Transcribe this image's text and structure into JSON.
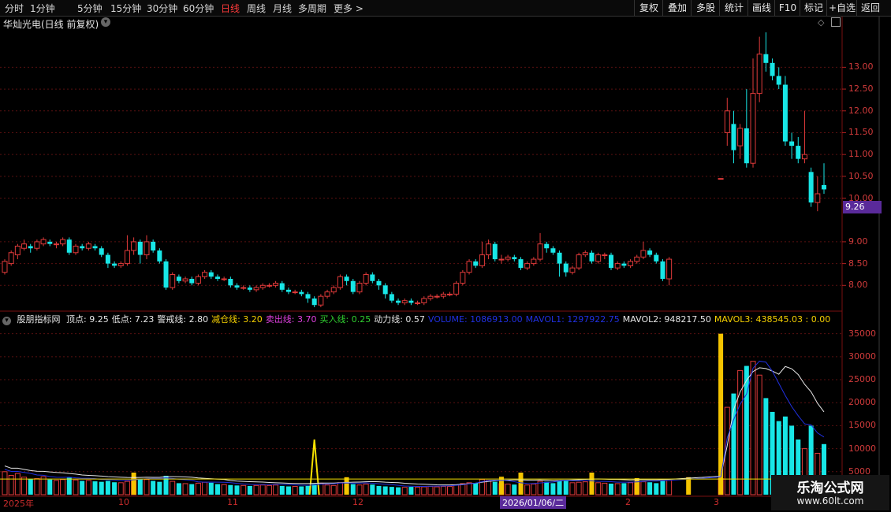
{
  "toolbar": {
    "periods": [
      "分时",
      "1分钟",
      "5分钟",
      "15分钟",
      "30分钟",
      "60分钟",
      "日线",
      "周线",
      "月线",
      "多周期",
      "更多 >"
    ],
    "active_period": "日线",
    "right_buttons": [
      "复权",
      "叠加",
      "多股",
      "统计",
      "画线",
      "F10",
      "标记",
      "+自选",
      "返回"
    ]
  },
  "chart_title": "华灿光电(日线 前复权)",
  "price_axis": {
    "ticks": [
      "13.00",
      "12.50",
      "12.00",
      "11.50",
      "11.00",
      "10.50",
      "10.00",
      "9.00",
      "8.50",
      "8.00"
    ],
    "current_price_label": "9.26"
  },
  "indicator": {
    "name": "股朋指标网",
    "items": [
      {
        "label": "顶点: 9.25",
        "color": "#e6e6e6"
      },
      {
        "label": "低点: 7.23",
        "color": "#e6e6e6"
      },
      {
        "label": "警戒线: 2.80",
        "color": "#e6e6e6"
      },
      {
        "label": "减仓线: 3.20",
        "color": "#f5d000"
      },
      {
        "label": "卖出线: 3.70",
        "color": "#e040e0"
      },
      {
        "label": "买入线: 0.25",
        "color": "#30d030"
      },
      {
        "label": "动力线: 0.57",
        "color": "#e6e6e6"
      },
      {
        "label": "VOLUME: 1086913.00",
        "color": "#2030e0"
      },
      {
        "label": "MAVOL1: 1297922.75",
        "color": "#2030e0"
      },
      {
        "label": "MAVOL2: 948217.50",
        "color": "#e6e6e6"
      },
      {
        "label": "MAVOL3: 438545.03 : 0.00",
        "color": "#f5d000"
      }
    ],
    "axis_ticks": [
      "35000",
      "30000",
      "25000",
      "20000",
      "15000",
      "10000",
      "5000"
    ]
  },
  "date_axis": {
    "labels": [
      "2025年",
      "10",
      "11",
      "12",
      "2026/01/06/二",
      "2",
      "3"
    ]
  },
  "watermark": {
    "line1": "乐淘公式网",
    "line2": "www.60lt.com"
  },
  "chart_data": {
    "type": "candlestick",
    "price_ylim": [
      7.5,
      14.0
    ],
    "candles": [
      [
        8.3,
        8.55,
        8.25,
        8.6
      ],
      [
        8.5,
        8.75,
        8.45,
        8.8
      ],
      [
        8.7,
        8.9,
        8.6,
        8.95
      ],
      [
        8.85,
        8.95,
        8.8,
        9.05
      ],
      [
        8.9,
        8.85,
        8.75,
        8.95
      ],
      [
        8.85,
        9.0,
        8.8,
        9.05
      ],
      [
        8.95,
        9.05,
        8.9,
        9.1
      ],
      [
        9.0,
        8.95,
        8.9,
        9.05
      ],
      [
        8.95,
        8.95,
        8.85,
        9.0
      ],
      [
        8.95,
        9.05,
        8.9,
        9.1
      ],
      [
        9.05,
        8.75,
        8.7,
        9.1
      ],
      [
        8.75,
        8.9,
        8.7,
        8.95
      ],
      [
        8.9,
        8.85,
        8.8,
        8.95
      ],
      [
        8.85,
        8.95,
        8.8,
        9.0
      ],
      [
        8.9,
        8.85,
        8.8,
        8.95
      ],
      [
        8.85,
        8.7,
        8.65,
        8.9
      ],
      [
        8.7,
        8.5,
        8.4,
        8.75
      ],
      [
        8.5,
        8.45,
        8.4,
        8.55
      ],
      [
        8.45,
        8.5,
        8.4,
        8.55
      ],
      [
        8.5,
        8.8,
        8.45,
        9.15
      ],
      [
        8.8,
        9.0,
        8.7,
        9.1
      ],
      [
        9.0,
        8.7,
        8.5,
        9.05
      ],
      [
        8.7,
        9.0,
        8.6,
        9.15
      ],
      [
        9.0,
        8.8,
        8.75,
        9.05
      ],
      [
        8.8,
        8.55,
        8.5,
        8.85
      ],
      [
        8.55,
        7.95,
        7.9,
        8.6
      ],
      [
        7.95,
        8.25,
        7.9,
        8.3
      ],
      [
        8.2,
        8.1,
        8.05,
        8.25
      ],
      [
        8.1,
        8.15,
        8.05,
        8.2
      ],
      [
        8.15,
        8.05,
        8.0,
        8.2
      ],
      [
        8.05,
        8.2,
        8.0,
        8.25
      ],
      [
        8.2,
        8.3,
        8.15,
        8.35
      ],
      [
        8.3,
        8.2,
        8.15,
        8.35
      ],
      [
        8.2,
        8.15,
        8.1,
        8.25
      ],
      [
        8.15,
        8.15,
        8.1,
        8.2
      ],
      [
        8.15,
        8.0,
        7.95,
        8.2
      ],
      [
        8.0,
        7.95,
        7.9,
        8.05
      ],
      [
        7.95,
        7.95,
        7.9,
        8.0
      ],
      [
        7.95,
        7.9,
        7.85,
        8.0
      ],
      [
        7.9,
        7.95,
        7.85,
        8.0
      ],
      [
        7.95,
        8.0,
        7.9,
        8.05
      ],
      [
        8.0,
        8.0,
        7.95,
        8.05
      ],
      [
        8.0,
        8.05,
        7.95,
        8.1
      ],
      [
        8.05,
        7.9,
        7.85,
        8.1
      ],
      [
        7.9,
        7.85,
        7.8,
        7.95
      ],
      [
        7.85,
        7.85,
        7.8,
        7.9
      ],
      [
        7.85,
        7.8,
        7.75,
        7.9
      ],
      [
        7.8,
        7.7,
        7.6,
        7.85
      ],
      [
        7.7,
        7.55,
        7.5,
        7.75
      ],
      [
        7.55,
        7.75,
        7.5,
        7.8
      ],
      [
        7.75,
        7.85,
        7.7,
        7.9
      ],
      [
        7.85,
        7.95,
        7.8,
        8.0
      ],
      [
        7.95,
        8.2,
        7.9,
        8.25
      ],
      [
        8.2,
        8.1,
        8.0,
        8.25
      ],
      [
        8.1,
        7.85,
        7.8,
        8.15
      ],
      [
        7.85,
        8.05,
        7.8,
        8.1
      ],
      [
        8.05,
        8.25,
        8.0,
        8.3
      ],
      [
        8.25,
        8.1,
        8.05,
        8.3
      ],
      [
        8.1,
        8.0,
        7.9,
        8.15
      ],
      [
        8.0,
        7.8,
        7.7,
        8.05
      ],
      [
        7.8,
        7.65,
        7.6,
        7.85
      ],
      [
        7.65,
        7.6,
        7.55,
        7.7
      ],
      [
        7.6,
        7.65,
        7.55,
        7.7
      ],
      [
        7.65,
        7.6,
        7.55,
        7.7
      ],
      [
        7.6,
        7.6,
        7.55,
        7.65
      ],
      [
        7.6,
        7.7,
        7.55,
        7.75
      ],
      [
        7.7,
        7.75,
        7.65,
        7.8
      ],
      [
        7.75,
        7.75,
        7.7,
        7.8
      ],
      [
        7.75,
        7.8,
        7.7,
        7.85
      ],
      [
        7.8,
        7.8,
        7.75,
        7.85
      ],
      [
        7.8,
        8.05,
        7.75,
        8.1
      ],
      [
        8.05,
        8.3,
        8.0,
        8.35
      ],
      [
        8.3,
        8.55,
        8.25,
        8.6
      ],
      [
        8.55,
        8.45,
        8.4,
        8.6
      ],
      [
        8.45,
        8.7,
        8.4,
        9.0
      ],
      [
        8.7,
        8.95,
        8.6,
        9.05
      ],
      [
        8.95,
        8.6,
        8.55,
        9.0
      ],
      [
        8.6,
        8.6,
        8.5,
        8.7
      ],
      [
        8.6,
        8.65,
        8.55,
        8.7
      ],
      [
        8.65,
        8.6,
        8.55,
        8.7
      ],
      [
        8.6,
        8.4,
        8.35,
        8.65
      ],
      [
        8.4,
        8.5,
        8.35,
        8.55
      ],
      [
        8.5,
        8.6,
        8.45,
        8.65
      ],
      [
        8.6,
        8.95,
        8.55,
        9.2
      ],
      [
        8.95,
        8.85,
        8.75,
        9.0
      ],
      [
        8.85,
        8.75,
        8.7,
        8.9
      ],
      [
        8.75,
        8.5,
        8.2,
        8.8
      ],
      [
        8.5,
        8.3,
        8.2,
        8.55
      ],
      [
        8.3,
        8.4,
        8.25,
        8.45
      ],
      [
        8.4,
        8.7,
        8.35,
        8.75
      ],
      [
        8.7,
        8.75,
        8.65,
        8.8
      ],
      [
        8.75,
        8.55,
        8.5,
        8.8
      ],
      [
        8.55,
        8.7,
        8.5,
        8.75
      ],
      [
        8.7,
        8.7,
        8.6,
        8.75
      ],
      [
        8.7,
        8.4,
        8.35,
        8.75
      ],
      [
        8.4,
        8.5,
        8.35,
        8.55
      ],
      [
        8.5,
        8.45,
        8.4,
        8.55
      ],
      [
        8.45,
        8.55,
        8.4,
        8.6
      ],
      [
        8.55,
        8.65,
        8.5,
        8.7
      ],
      [
        8.65,
        8.8,
        8.6,
        9.0
      ],
      [
        8.8,
        8.7,
        8.65,
        8.85
      ],
      [
        8.7,
        8.55,
        8.5,
        8.75
      ],
      [
        8.55,
        8.15,
        8.1,
        8.6
      ],
      [
        8.15,
        8.6,
        8.0,
        8.65
      ],
      null,
      null,
      null,
      null,
      null,
      null,
      null,
      [
        10.45,
        10.45,
        10.45,
        10.45
      ],
      [
        11.5,
        12.0,
        11.2,
        12.3
      ],
      [
        11.7,
        11.1,
        10.8,
        12.0
      ],
      [
        11.2,
        11.6,
        10.9,
        11.7
      ],
      [
        11.6,
        10.8,
        10.7,
        12.5
      ],
      [
        10.8,
        12.4,
        10.7,
        13.2
      ],
      [
        12.4,
        13.3,
        12.2,
        13.7
      ],
      [
        13.3,
        13.1,
        12.9,
        13.8
      ],
      [
        13.1,
        12.8,
        12.7,
        13.2
      ],
      [
        12.8,
        12.6,
        12.5,
        13.0
      ],
      [
        12.6,
        11.3,
        11.2,
        12.8
      ],
      [
        11.3,
        11.2,
        10.9,
        11.5
      ],
      [
        11.2,
        10.9,
        10.8,
        11.4
      ],
      [
        10.9,
        11.0,
        10.8,
        12.0
      ],
      [
        10.6,
        9.9,
        9.8,
        10.7
      ],
      [
        9.9,
        10.1,
        9.7,
        10.5
      ],
      [
        10.3,
        10.2,
        10.1,
        10.8
      ]
    ],
    "volume_ylim": [
      0,
      37000
    ],
    "volumes": [
      5000,
      4200,
      4600,
      3800,
      3400,
      3500,
      3900,
      3300,
      3100,
      3300,
      3700,
      3200,
      3000,
      3100,
      2900,
      2800,
      3000,
      2700,
      2600,
      2900,
      3600,
      3400,
      3300,
      3000,
      2800,
      4100,
      2900,
      2500,
      2400,
      2300,
      2500,
      2700,
      2600,
      2300,
      2200,
      2100,
      2000,
      2000,
      1900,
      2000,
      2100,
      2000,
      2100,
      1900,
      1800,
      1800,
      1800,
      1900,
      2300,
      2500,
      2100,
      2000,
      2600,
      2400,
      2300,
      2100,
      2300,
      2200,
      1900,
      1800,
      1700,
      1600,
      1600,
      1700,
      1600,
      1700,
      1800,
      1700,
      1800,
      1800,
      2100,
      2400,
      2600,
      2500,
      3300,
      3100,
      2800,
      2400,
      2300,
      2200,
      2100,
      2100,
      2300,
      2900,
      2800,
      2500,
      3000,
      3000,
      2600,
      2700,
      2800,
      2500,
      2600,
      2500,
      2400,
      2400,
      2500,
      2600,
      2800,
      2800,
      2700,
      2500,
      3000,
      3100,
      null,
      null,
      null,
      null,
      null,
      null,
      null,
      3500,
      19000,
      22000,
      27000,
      28000,
      29000,
      26000,
      21000,
      18000,
      16000,
      17000,
      15000,
      12000,
      10000,
      15000,
      9000,
      11000
    ],
    "yellow_bar_heights": [
      0,
      0,
      0,
      0,
      0,
      0,
      0,
      0,
      0,
      0,
      0,
      0,
      0,
      0,
      0,
      0,
      0,
      0,
      0,
      0,
      0,
      0,
      0,
      0,
      0,
      0,
      0,
      0,
      0,
      0,
      0,
      0,
      0,
      0,
      0,
      0,
      0,
      0,
      0,
      0,
      0,
      0,
      0,
      0,
      0,
      0,
      0,
      0,
      0,
      0,
      0,
      0,
      0,
      0,
      0,
      0,
      0,
      0,
      0,
      0,
      0,
      0,
      0,
      0,
      0,
      0,
      0,
      0,
      0,
      0,
      0,
      0,
      0,
      0,
      0,
      0,
      0,
      0,
      0,
      0,
      0,
      0,
      0,
      0,
      0,
      0,
      0,
      0,
      0,
      0,
      0,
      0,
      0,
      0,
      0,
      0,
      0,
      0,
      0,
      0,
      0,
      0,
      0,
      0
    ],
    "yellow_signal_bars": [
      {
        "i": 20,
        "v": 4800
      },
      {
        "i": 53,
        "v": 3800
      },
      {
        "i": 77,
        "v": 3900
      },
      {
        "i": 80,
        "v": 4800
      },
      {
        "i": 91,
        "v": 4800
      },
      {
        "i": 98,
        "v": 3600
      },
      {
        "i": 106,
        "v": 3800
      },
      {
        "i": 111,
        "v": 35000
      }
    ],
    "yellow_spike": {
      "i": 48,
      "v": 12000
    }
  }
}
